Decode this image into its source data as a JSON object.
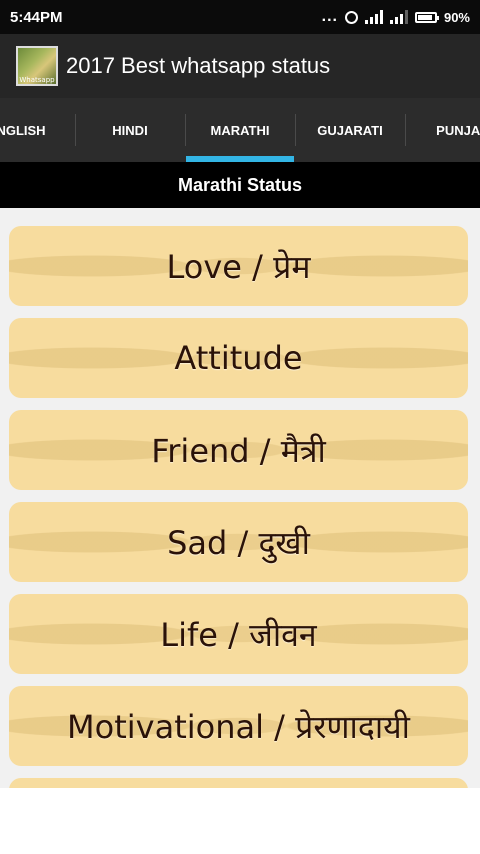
{
  "status_bar": {
    "time": "5:44PM",
    "battery_text": "90%",
    "battery_level": 0.9,
    "dots": "..."
  },
  "app_bar": {
    "title": "2017 Best whatsapp status",
    "icon_text": "Whatsapp"
  },
  "tabs": [
    {
      "label": "NGLISH",
      "selected": false
    },
    {
      "label": "HINDI",
      "selected": false
    },
    {
      "label": "MARATHI",
      "selected": true
    },
    {
      "label": "GUJARATI",
      "selected": false
    },
    {
      "label": "PUNJAI",
      "selected": false
    }
  ],
  "section_header": "Marathi Status",
  "categories": [
    {
      "label": "Love / प्रेम"
    },
    {
      "label": "Attitude"
    },
    {
      "label": "Friend / मैत्री"
    },
    {
      "label": "Sad / दुखी"
    },
    {
      "label": "Life / जीवन"
    },
    {
      "label": "Motivational / प्रेरणादायी"
    }
  ],
  "colors": {
    "tab_indicator": "#33b5e5",
    "card_background": "#f7dc9e",
    "card_text": "#2a1208"
  }
}
